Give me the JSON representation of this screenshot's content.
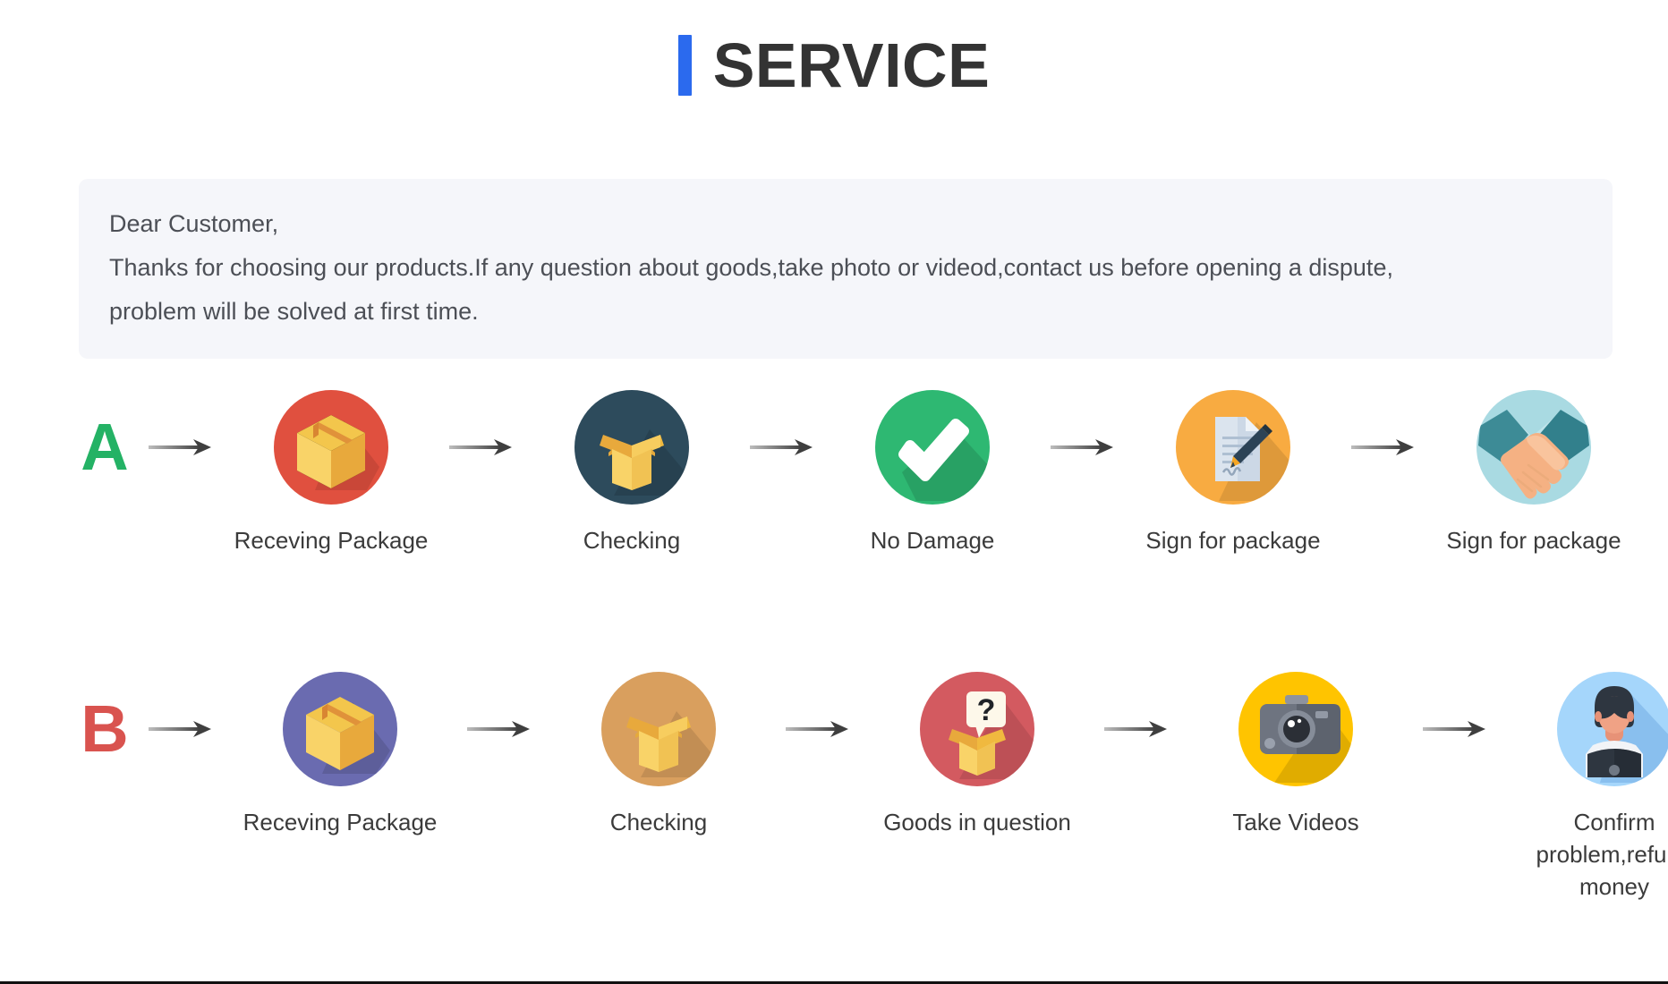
{
  "header": {
    "title": "SERVICE",
    "accent_color": "#2b6aee",
    "title_color": "#333333"
  },
  "notice": {
    "background_color": "#f5f6fa",
    "line1": "Dear Customer,",
    "line2": "Thanks for choosing our products.If any question about goods,take photo or videod,contact us before opening a dispute,",
    "line3": "problem will be solved at first time."
  },
  "flows": [
    {
      "badge": "A",
      "badge_color": "#24b265",
      "steps": [
        {
          "label": "Receving Package",
          "icon": "package-box-icon",
          "circle_color": "#e0503f"
        },
        {
          "label": "Checking",
          "icon": "open-box-icon",
          "circle_color": "#2d4b5c"
        },
        {
          "label": "No Damage",
          "icon": "check-mark-icon",
          "circle_color": "#2eb872"
        },
        {
          "label": "Sign for package",
          "icon": "document-pen-icon",
          "circle_color": "#f8ab41"
        },
        {
          "label": "Sign for package",
          "icon": "handshake-icon",
          "circle_color": "#a9dae2"
        }
      ]
    },
    {
      "badge": "B",
      "badge_color": "#d9534f",
      "steps": [
        {
          "label": "Receving Package",
          "icon": "package-box-icon",
          "circle_color": "#6a6bb0"
        },
        {
          "label": "Checking",
          "icon": "open-box-icon",
          "circle_color": "#d99f5e"
        },
        {
          "label": "Goods in question",
          "icon": "question-box-icon",
          "circle_color": "#d35a60"
        },
        {
          "label": "Take Videos",
          "icon": "camera-icon",
          "circle_color": "#ffc400"
        },
        {
          "label": "Confirm  problem,refund money",
          "icon": "support-person-icon",
          "circle_color": "#a5d6fb"
        }
      ]
    }
  ],
  "arrow": {
    "name": "right-arrow-icon",
    "color": "#4a4a4a"
  }
}
